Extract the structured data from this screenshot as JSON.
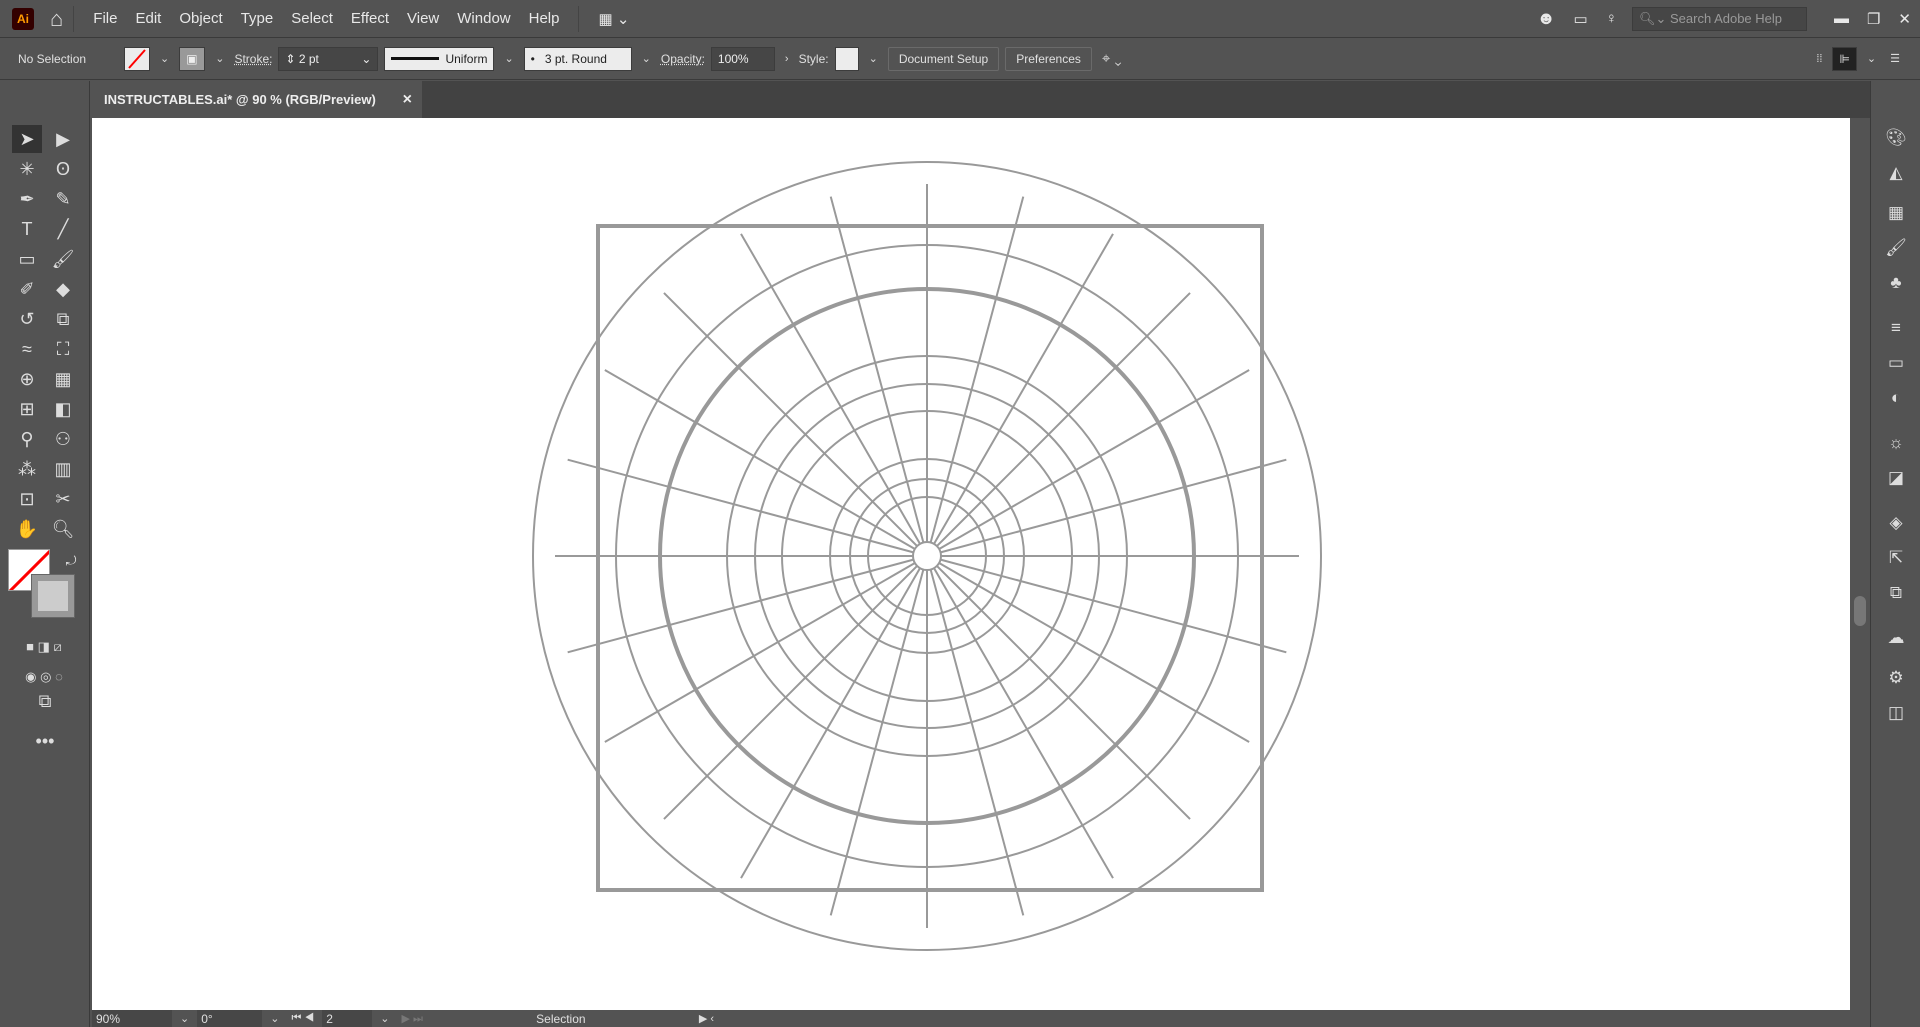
{
  "app": {
    "logo": "Ai"
  },
  "menu": [
    "File",
    "Edit",
    "Object",
    "Type",
    "Select",
    "Effect",
    "View",
    "Window",
    "Help"
  ],
  "search": {
    "placeholder": "Search Adobe Help"
  },
  "control": {
    "selection": "No Selection",
    "stroke_label": "Stroke:",
    "stroke_value": "2 pt",
    "profile": "Uniform",
    "brush": "3 pt. Round",
    "opacity_label": "Opacity:",
    "opacity_value": "100%",
    "style_label": "Style:",
    "doc_setup": "Document Setup",
    "preferences": "Preferences"
  },
  "document_tab": {
    "title": "INSTRUCTABLES.ai* @ 90 % (RGB/Preview)",
    "close": "×"
  },
  "status": {
    "zoom": "90%",
    "rotation": "0°",
    "artboard": "2",
    "tool": "Selection"
  },
  "colors": {
    "artwork": "#999999",
    "accent": "#ff9a00"
  }
}
